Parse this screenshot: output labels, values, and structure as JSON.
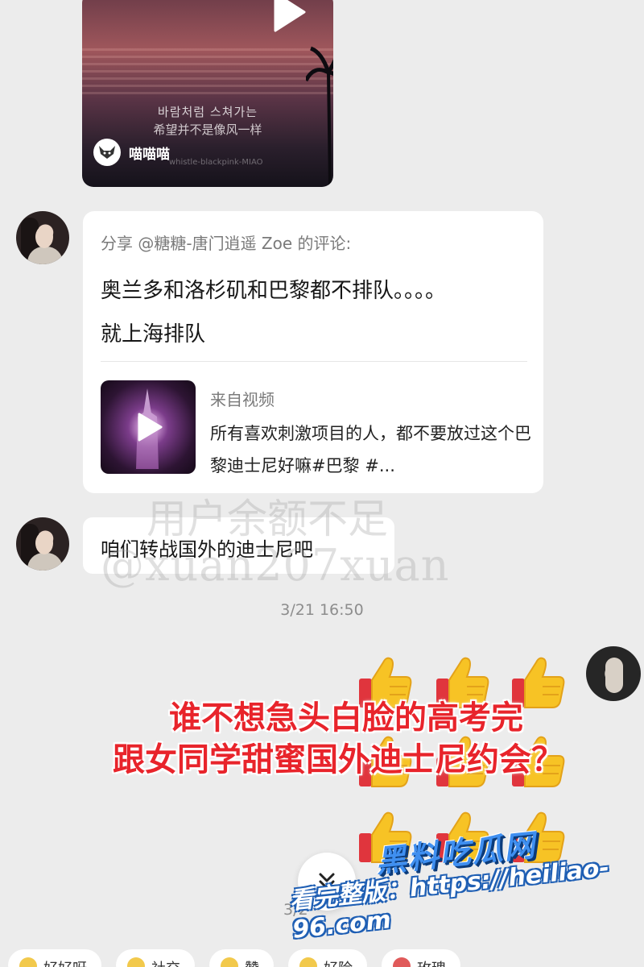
{
  "video_card": {
    "subtitle_korean": "바람처럼 스쳐가는",
    "subtitle_chinese": "希望并不是像风一样",
    "author": "喵喵喵",
    "watermark": "whistle-blackpink-MIAO"
  },
  "share_card": {
    "header": "分享 @糖糖-唐门逍遥 Zoe 的评论:",
    "body": "奥兰多和洛杉矶和巴黎都不排队。。。。就上海排队",
    "from_label": "来自视频",
    "from_desc": "所有喜欢刺激项目的人，都不要放过这个巴黎迪士尼好嘛#巴黎 #..."
  },
  "message": {
    "text": "咱们转战国外的迪士尼吧"
  },
  "overlay_watermark": {
    "line1": "用户余额不足",
    "line2": "@xuan207xuan"
  },
  "timestamp": "3/21 16:50",
  "partial_timestamp": "3/2",
  "caption": {
    "line1": "谁不想急头白脸的高考完",
    "line2": "跟女同学甜蜜国外迪士尼约会？"
  },
  "brand": {
    "title": "黑料吃瓜网",
    "url": "看完整版：https://heiliao-96.com"
  },
  "quick_replies": [
    {
      "label": "好好呀",
      "color": "#f2c94c"
    },
    {
      "label": "社交",
      "color": "#f2c94c"
    },
    {
      "label": "赞",
      "color": "#f2c94c"
    },
    {
      "label": "好险",
      "color": "#f2c94c"
    },
    {
      "label": "玫瑰",
      "color": "#e05a5a"
    }
  ],
  "colors": {
    "caption_red": "#e8242b",
    "brand_blue": "#3f8ff0",
    "bubble_bg": "#ffffff",
    "page_bg": "#ececec"
  }
}
